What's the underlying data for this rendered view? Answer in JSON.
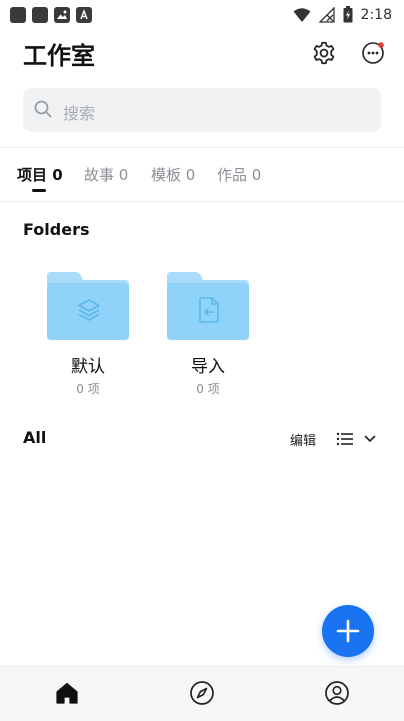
{
  "status_bar": {
    "time": "2:18"
  },
  "header": {
    "title": "工作室"
  },
  "search": {
    "placeholder": "搜索"
  },
  "tabs": [
    {
      "label": "项目 0",
      "active": true
    },
    {
      "label": "故事 0",
      "active": false
    },
    {
      "label": "模板 0",
      "active": false
    },
    {
      "label": "作品 0",
      "active": false
    }
  ],
  "folders_section": {
    "title": "Folders",
    "items": [
      {
        "name": "默认",
        "count": "0 项",
        "icon": "layers-icon"
      },
      {
        "name": "导入",
        "count": "0 项",
        "icon": "import-file-icon"
      }
    ]
  },
  "all_section": {
    "title": "All",
    "edit_label": "编辑"
  },
  "colors": {
    "accent": "#1a73f0",
    "folder": "#8fd3fb",
    "notification_dot": "#e53935"
  }
}
